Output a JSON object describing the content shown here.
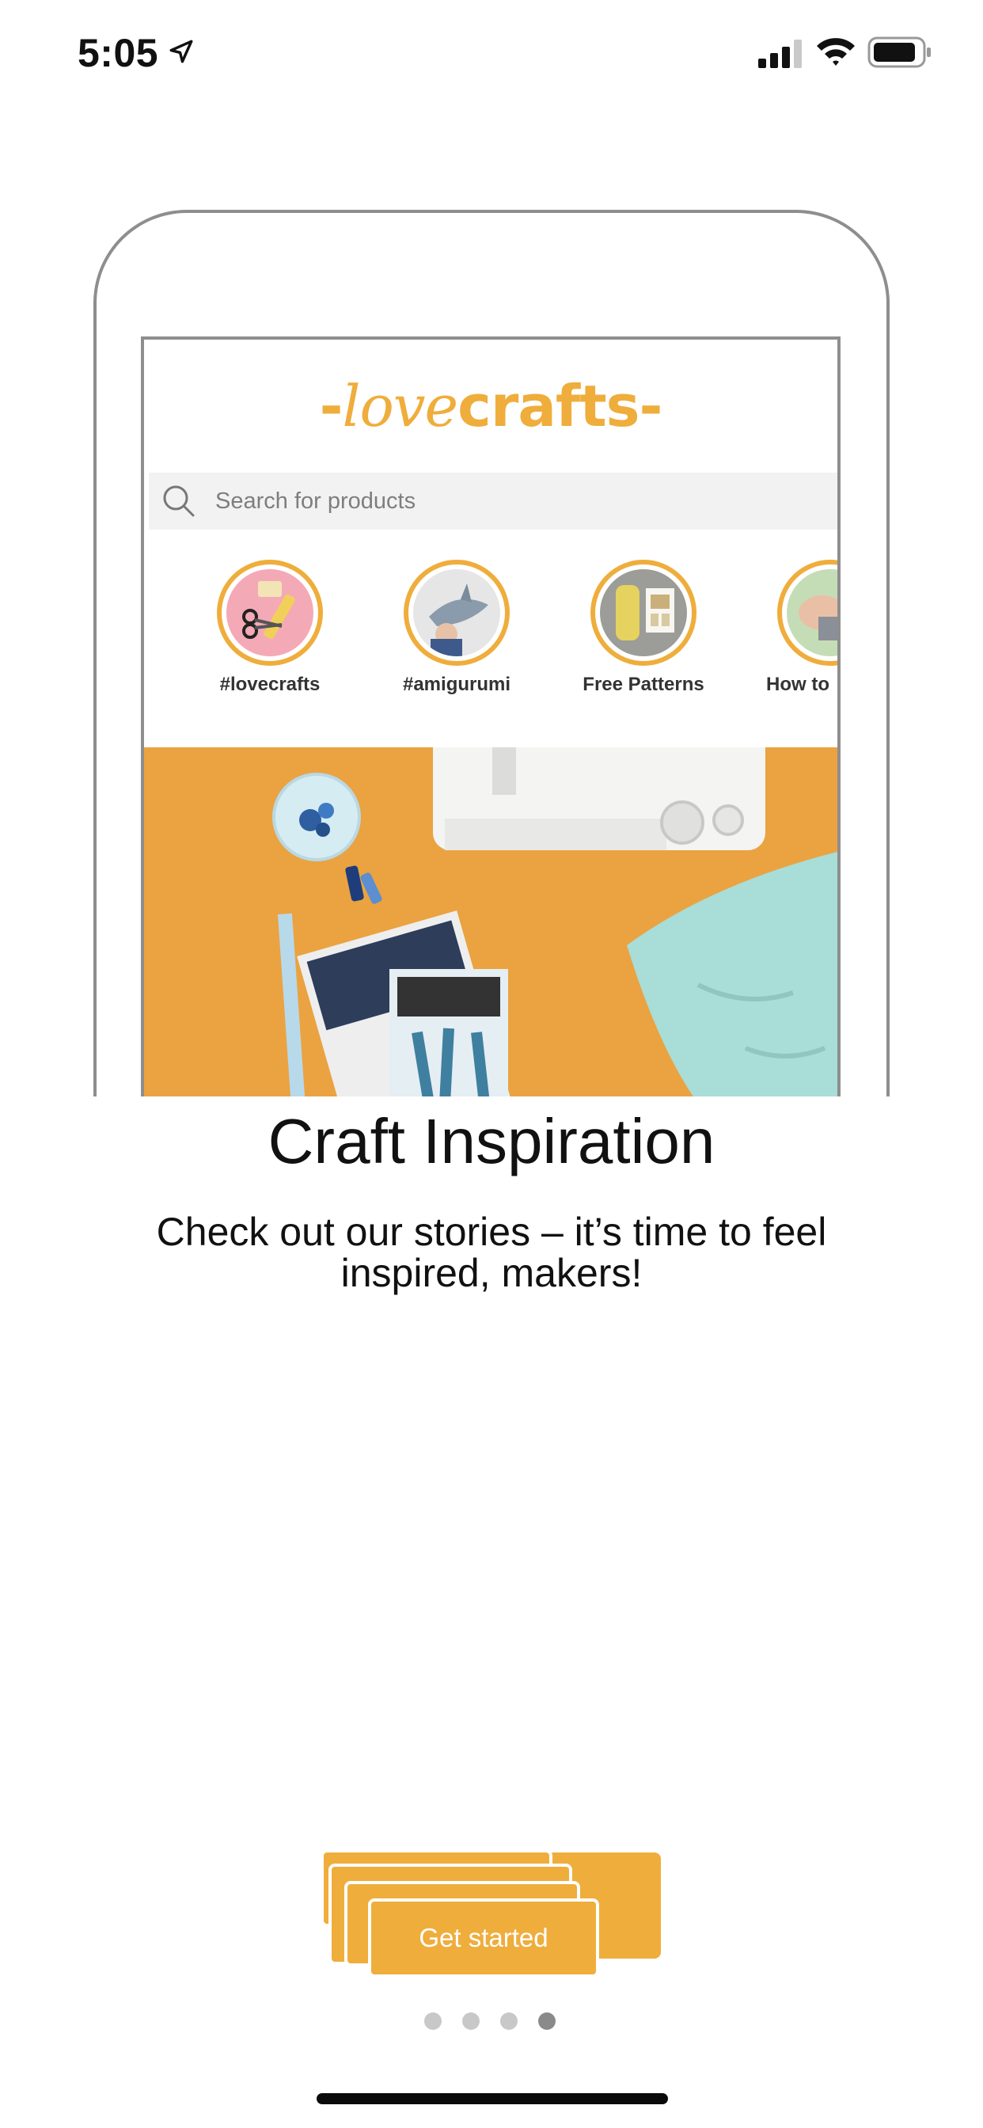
{
  "status_bar": {
    "time": "5:05"
  },
  "mockup": {
    "logo_prefix": "-",
    "logo_love": "love",
    "logo_crafts": "crafts",
    "logo_suffix": "-",
    "search_placeholder": "Search for products",
    "stories": [
      {
        "label": "#lovecrafts"
      },
      {
        "label": "#amigurumi"
      },
      {
        "label": "Free Patterns"
      },
      {
        "label": "How to"
      }
    ]
  },
  "onboarding": {
    "title": "Craft Inspiration",
    "subtitle": "Check out our stories – it’s time to feel inspired, makers!",
    "button_label": "Get started",
    "page_count": 4,
    "current_page": 4
  },
  "colors": {
    "accent": "#efad3c",
    "hero_bg": "#eaa340",
    "frame": "#8e8e8e"
  }
}
